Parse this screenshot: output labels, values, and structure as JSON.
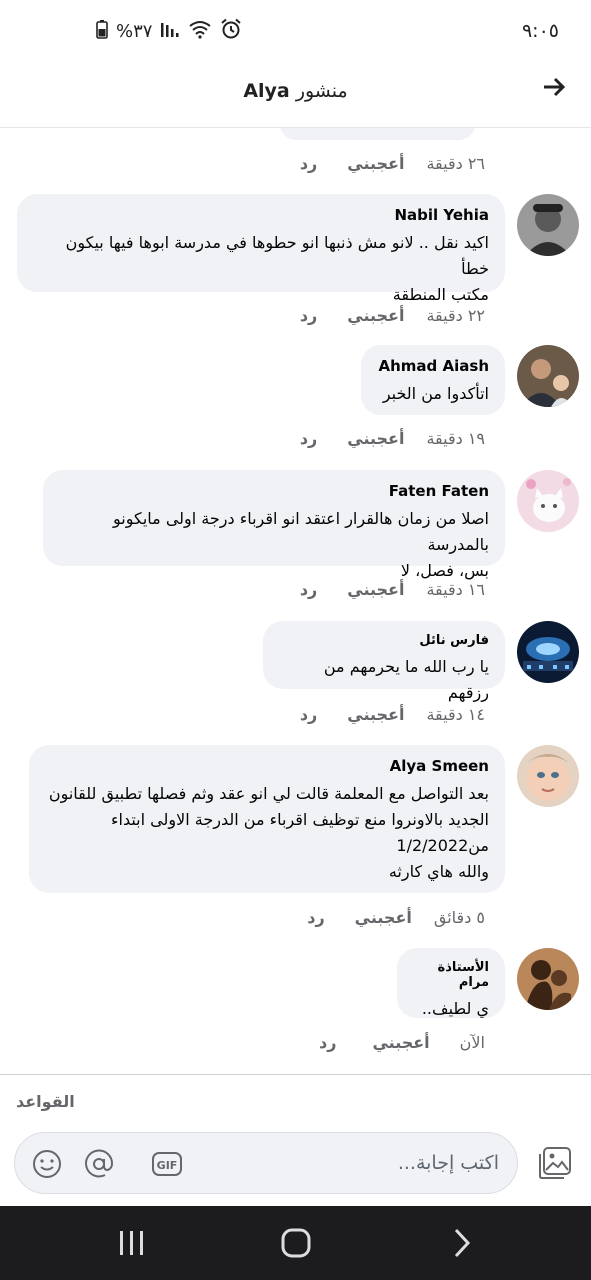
{
  "status": {
    "time": "٩:٠٥",
    "battery_text": "%٣٧"
  },
  "header": {
    "title_prefix": "منشور",
    "title_name": "Alya",
    "back_icon": "arrow-right-icon"
  },
  "top_actions": {
    "time": "٢٦ دقيقة",
    "like": "أعجبني",
    "reply": "رد"
  },
  "comments": [
    {
      "name": "Nabil Yehia",
      "text": "اكيد نقل .. لانو مش ذنبها انو حطوها في مدرسة ابوها فيها بيكون خطأ\nمكتب المنطقة",
      "time": "٢٢ دقيقة",
      "like": "أعجبني",
      "reply": "رد"
    },
    {
      "name": "Ahmad Aiash",
      "text": "اتأكدوا من الخبر",
      "time": "١٩ دقيقة",
      "like": "أعجبني",
      "reply": "رد"
    },
    {
      "name": "Faten Faten",
      "text": "اصلا من زمان هالقرار اعتقد انو اقرباء درجة اولى مايكونو بالمدرسة\nبس، فصل، لا",
      "time": "١٦ دقيقة",
      "like": "أعجبني",
      "reply": "رد"
    },
    {
      "name": "فارس نائل",
      "text": "يا رب الله ما يحرمهم من رزقهم",
      "time": "١٤ دقيقة",
      "like": "أعجبني",
      "reply": "رد"
    },
    {
      "name": "Alya Smeen",
      "text": "بعد التواصل مع المعلمة قالت لي انو عقد وثم فصلها تطبيق للقانون\nالجديد بالاونروا منع توظيف اقرباء من الدرجة الاولى ابتداء\nمن1/2/2022\nوالله هاي كارثه",
      "time": "٥ دقائق",
      "like": "أعجبني",
      "reply": "رد"
    },
    {
      "name": "الأستاذة مرام",
      "text": "ي لطيف..",
      "time": "الآن",
      "like": "أعجبني",
      "reply": "رد"
    }
  ],
  "footer": {
    "rules_label": "القواعد",
    "composer_placeholder": "اكتب إجابة..."
  }
}
